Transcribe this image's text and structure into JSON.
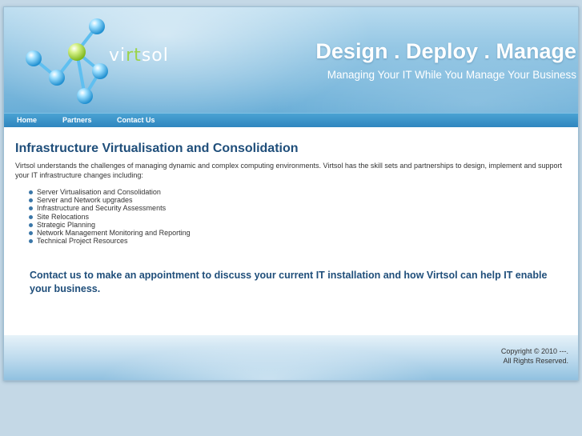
{
  "brand": {
    "logo_text_before": "vi",
    "logo_text_accent": "rt",
    "logo_text_after": "sol",
    "tagline": "Design . Deploy . Manage",
    "subtagline": "Managing Your IT While You Manage Your Business",
    "colors": {
      "accent": "#9bd34a",
      "header_blue": "#6aaed7",
      "title_blue": "#1f4e7a"
    }
  },
  "nav": {
    "items": [
      {
        "label": "Home"
      },
      {
        "label": "Partners"
      },
      {
        "label": "Contact Us"
      }
    ]
  },
  "main": {
    "title": "Infrastructure Virtualisation and Consolidation",
    "intro": "Virtsol understands the challenges of managing dynamic and complex computing environments. Virtsol has the skill sets and partnerships to design, implement and support your IT infrastructure changes including:",
    "services": [
      "Server Virtualisation and Consolidation",
      "Server and Network upgrades",
      "Infrastructure and Security Assessments",
      "Site Relocations",
      "Strategic Planning",
      "Network Management Monitoring and Reporting",
      "Technical Project Resources"
    ],
    "cta": "Contact us to make an appointment to discuss your current IT installation and how Virtsol can help IT enable your business."
  },
  "footer": {
    "copyright_line1": "Copyright © 2010 ---.",
    "copyright_line2": "All Rights Reserved."
  }
}
